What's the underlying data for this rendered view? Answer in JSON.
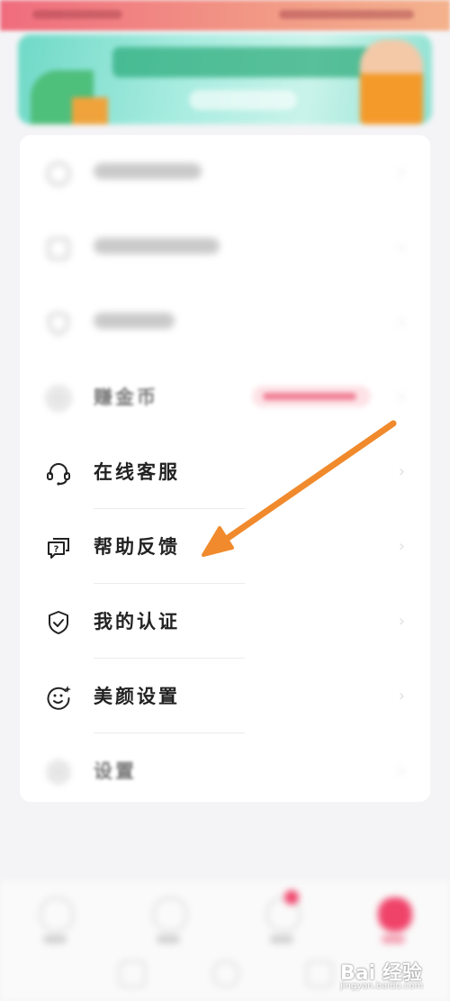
{
  "menu": {
    "items": [
      {
        "key": "blurred-1",
        "label": "",
        "blurred": true
      },
      {
        "key": "blurred-2",
        "label": "",
        "blurred": true
      },
      {
        "key": "blurred-3",
        "label": "",
        "blurred": true
      },
      {
        "key": "earn-coins",
        "label": "赚金币",
        "blurred": true,
        "has_badge": true
      },
      {
        "key": "online-service",
        "label": "在线客服",
        "icon": "headset-icon"
      },
      {
        "key": "help-feedback",
        "label": "帮助反馈",
        "icon": "help-chat-icon"
      },
      {
        "key": "my-certification",
        "label": "我的认证",
        "icon": "shield-check-icon"
      },
      {
        "key": "beauty-settings",
        "label": "美颜设置",
        "icon": "face-sparkle-icon"
      },
      {
        "key": "settings",
        "label": "设置",
        "blurred": true,
        "icon": "hexagon-gear-icon"
      }
    ]
  },
  "watermark": {
    "brand": "Bai 经验",
    "url": "jingyan.baidu.com"
  },
  "colors": {
    "accent": "#f0436a",
    "arrow": "#f08a2c",
    "banner": "#8fe1d2"
  }
}
